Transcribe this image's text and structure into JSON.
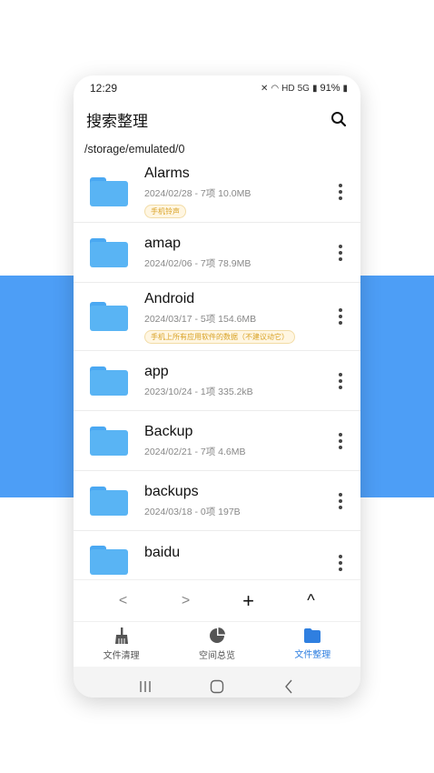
{
  "status": {
    "time": "12:29",
    "battery": "91%",
    "signal": "HD",
    "net": "5G"
  },
  "appbar": {
    "title": "搜索整理"
  },
  "path": "/storage/emulated/0",
  "files": [
    {
      "name": "Alarms",
      "meta": "2024/02/28 - 7项 10.0MB",
      "tag": "手机铃声"
    },
    {
      "name": "amap",
      "meta": "2024/02/06 - 7项 78.9MB",
      "tag": ""
    },
    {
      "name": "Android",
      "meta": "2024/03/17 - 5项 154.6MB",
      "tag": "手机上所有应用软件的数据（不建议动它）"
    },
    {
      "name": "app",
      "meta": "2023/10/24 - 1项 335.2kB",
      "tag": ""
    },
    {
      "name": "Backup",
      "meta": "2024/02/21 - 7项 4.6MB",
      "tag": ""
    },
    {
      "name": "backups",
      "meta": "2024/03/18 - 0项 197B",
      "tag": ""
    },
    {
      "name": "baidu",
      "meta": "",
      "tag": ""
    }
  ],
  "toolbar": {
    "back": "<",
    "forward": ">",
    "add": "+",
    "up": "^"
  },
  "tabs": [
    {
      "label": "文件清理",
      "icon": "broom-icon"
    },
    {
      "label": "空间总览",
      "icon": "pie-chart-icon"
    },
    {
      "label": "文件整理",
      "icon": "folder-icon",
      "active": true
    }
  ],
  "colors": {
    "band": "#4d9ef6",
    "folder": "#59b4f4",
    "accent": "#2f7fe0",
    "tag_text": "#d9a327"
  }
}
